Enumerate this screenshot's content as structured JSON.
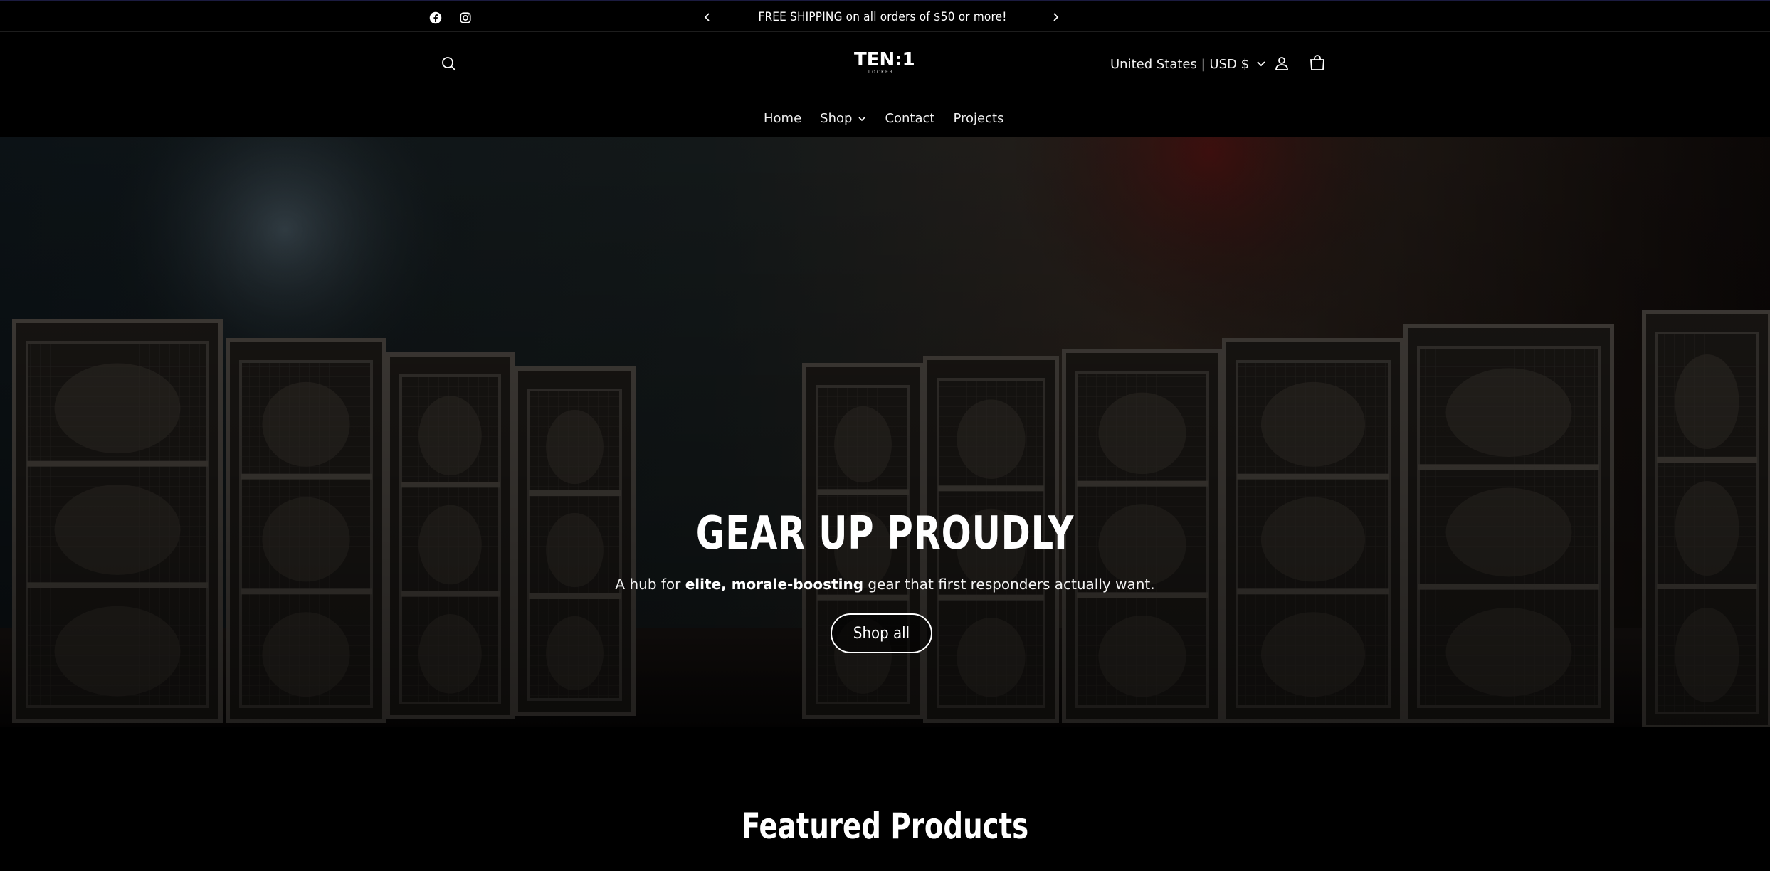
{
  "announcement": {
    "text": "FREE SHIPPING on all orders of $50 or more!",
    "prev_icon": "chevron-left-icon",
    "next_icon": "chevron-right-icon"
  },
  "social": [
    "facebook-icon",
    "instagram-icon"
  ],
  "header": {
    "logo_text": "TEN:1",
    "logo_subtext": "LOCKER",
    "locale_label": "United States | USD $",
    "icons": [
      "search-icon",
      "account-icon",
      "cart-icon"
    ]
  },
  "nav": {
    "items": [
      {
        "label": "Home",
        "active": true
      },
      {
        "label": "Shop",
        "has_dropdown": true
      },
      {
        "label": "Contact"
      },
      {
        "label": "Projects"
      }
    ]
  },
  "hero": {
    "title": "GEAR UP PROUDLY",
    "subtitle_pre": "A hub for ",
    "subtitle_bold": "elite, morale-boosting",
    "subtitle_post": " gear that first responders actually want.",
    "button_label": "Shop all"
  },
  "featured": {
    "title": "Featured Products"
  },
  "colors": {
    "background": "#000000",
    "text": "#ffffff",
    "announcement_border": "#1b1b40"
  }
}
